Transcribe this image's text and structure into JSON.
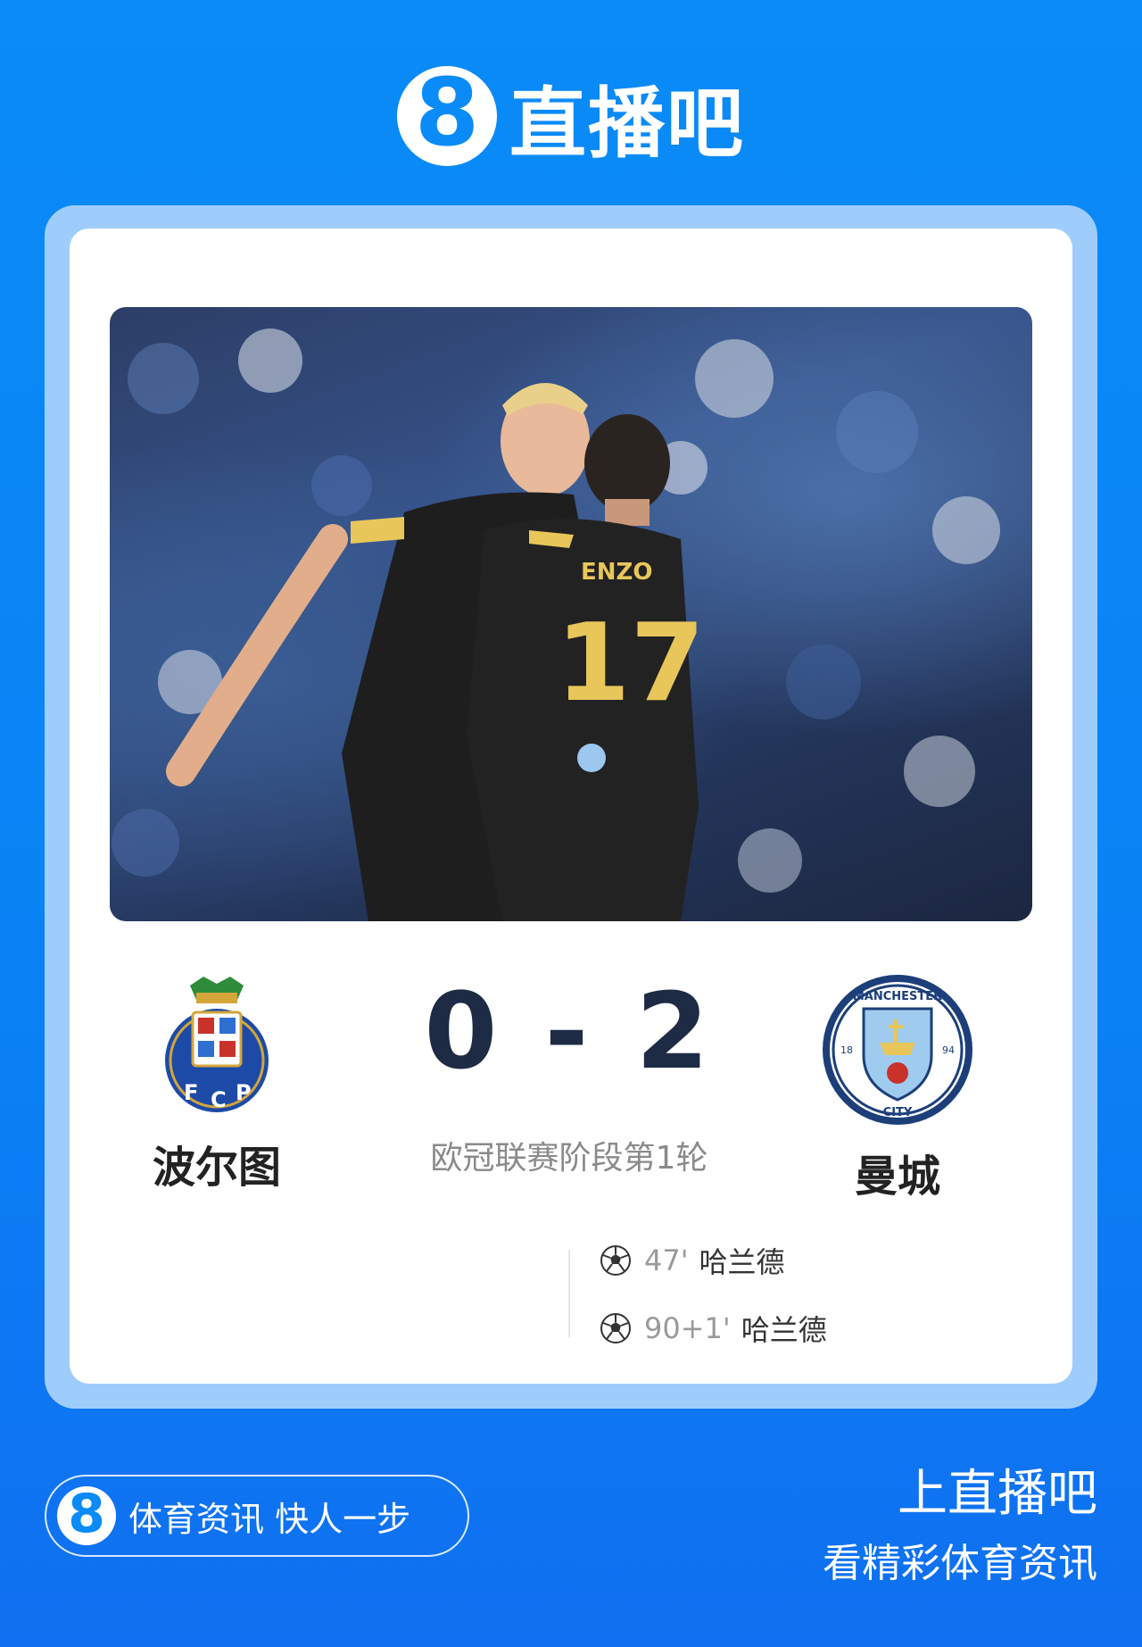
{
  "brand": {
    "badge_glyph": "8",
    "name": "直播吧"
  },
  "match": {
    "home_team": "波尔图",
    "away_team": "曼城",
    "score": "0 - 2",
    "competition": "欧冠联赛阶段第1轮",
    "goals": [
      {
        "minute": "47'",
        "scorer": "哈兰德"
      },
      {
        "minute": "90+1'",
        "scorer": "哈兰德"
      }
    ]
  },
  "photo": {
    "jersey_name": "ENZO",
    "jersey_number": "17"
  },
  "footer": {
    "pill_badge_glyph": "8",
    "slogan": "体育资讯 快人一步",
    "line1": "上直播吧",
    "line2": "看精彩体育资讯"
  },
  "colors": {
    "background": "#0a8bf7",
    "card_frame": "#9fcdfb",
    "score": "#1d2b45"
  }
}
